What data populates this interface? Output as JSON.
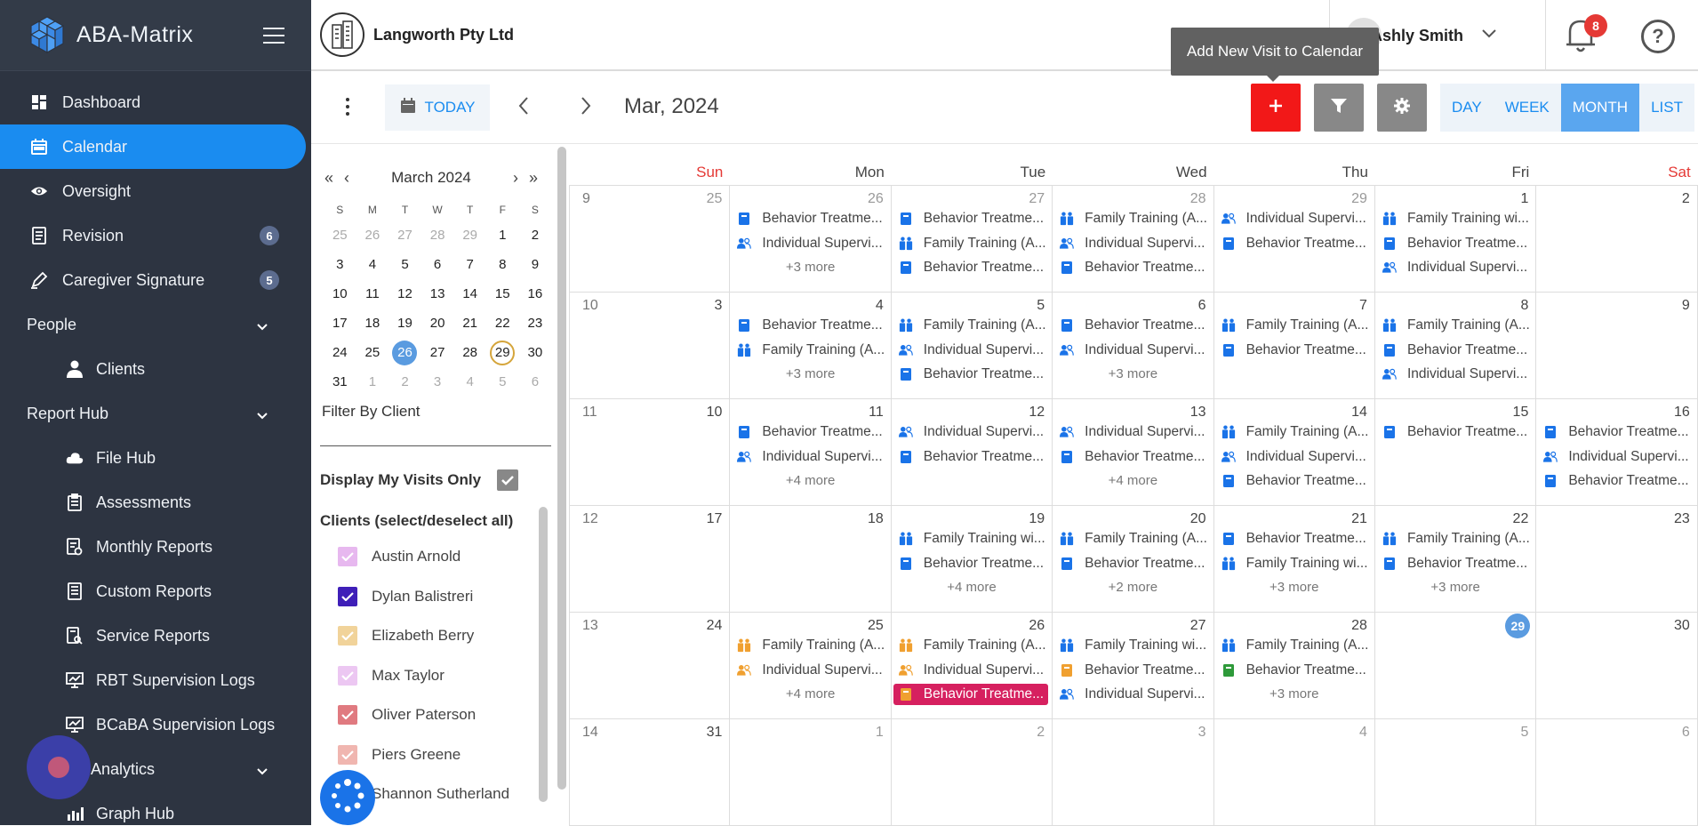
{
  "app": {
    "name": "ABA-Matrix"
  },
  "sidebar": {
    "items": [
      {
        "label": "Dashboard",
        "icon": "dashboard-icon"
      },
      {
        "label": "Calendar",
        "icon": "calendar-icon",
        "active": true
      },
      {
        "label": "Oversight",
        "icon": "eye-icon"
      },
      {
        "label": "Revision",
        "icon": "document-icon",
        "badge": "6"
      },
      {
        "label": "Caregiver Signature",
        "icon": "pen-icon",
        "badge": "5"
      }
    ],
    "people": {
      "label": "People",
      "items": [
        {
          "label": "Clients"
        }
      ]
    },
    "report_hub": {
      "label": "Report Hub",
      "items": [
        {
          "label": "File Hub"
        },
        {
          "label": "Assessments"
        },
        {
          "label": "Monthly Reports"
        },
        {
          "label": "Custom Reports"
        },
        {
          "label": "Service Reports"
        },
        {
          "label": "RBT Supervision Logs"
        },
        {
          "label": "BCaBA Supervision Logs"
        }
      ]
    },
    "analytics": {
      "label": "Analytics",
      "items": [
        {
          "label": "Graph Hub"
        }
      ]
    }
  },
  "topbar": {
    "company": "Langworth Pty Ltd",
    "user": "Ashly Smith",
    "notifications": "8",
    "tooltip": "Add New Visit to Calendar"
  },
  "toolbar": {
    "today": "TODAY",
    "month_label": "Mar, 2024",
    "views": [
      "DAY",
      "WEEK",
      "MONTH",
      "LIST"
    ],
    "active_view": "MONTH"
  },
  "mini_calendar": {
    "title": "March 2024",
    "dow": [
      "S",
      "M",
      "T",
      "W",
      "T",
      "F",
      "S"
    ],
    "weeks": [
      [
        "25",
        "26",
        "27",
        "28",
        "29",
        "1",
        "2"
      ],
      [
        "3",
        "4",
        "5",
        "6",
        "7",
        "8",
        "9"
      ],
      [
        "10",
        "11",
        "12",
        "13",
        "14",
        "15",
        "16"
      ],
      [
        "17",
        "18",
        "19",
        "20",
        "21",
        "22",
        "23"
      ],
      [
        "24",
        "25",
        "26",
        "27",
        "28",
        "29",
        "30"
      ],
      [
        "31",
        "1",
        "2",
        "3",
        "4",
        "5",
        "6"
      ]
    ],
    "selected": "26",
    "today": "29"
  },
  "filters": {
    "filter_by_client": "Filter By Client",
    "display_my_visits": "Display My Visits Only",
    "clients_header": "Clients (select/deselect all)",
    "clients": [
      {
        "name": "Austin Arnold",
        "color": "#e7b8ef"
      },
      {
        "name": "Dylan Balistreri",
        "color": "#3f1fb8"
      },
      {
        "name": "Elizabeth Berry",
        "color": "#f1d39a"
      },
      {
        "name": "Max Taylor",
        "color": "#ecc7f2"
      },
      {
        "name": "Oliver Paterson",
        "color": "#e07a80"
      },
      {
        "name": "Piers Greene",
        "color": "#f0b6b0"
      },
      {
        "name": "Shannon Sutherland",
        "color": "#5a9be0"
      }
    ]
  },
  "calendar": {
    "dow": [
      "Sun",
      "Mon",
      "Tue",
      "Wed",
      "Thu",
      "Fri",
      "Sat"
    ],
    "colors": {
      "weekend": "#e53935",
      "blue": "#1a73e8",
      "orange": "#f0a030",
      "green": "#2e9a3a",
      "highlight": "#d6205f"
    },
    "weeks": [
      {
        "wk": "9",
        "days": [
          {
            "d": "25",
            "mut": true,
            "events": []
          },
          {
            "d": "26",
            "mut": true,
            "events": [
              {
                "t": "Behavior Treatme...",
                "i": "book"
              },
              {
                "t": "Individual Supervi...",
                "i": "people"
              }
            ],
            "more": "+3 more"
          },
          {
            "d": "27",
            "mut": true,
            "events": [
              {
                "t": "Behavior Treatme...",
                "i": "book"
              },
              {
                "t": "Family Training (A...",
                "i": "family"
              },
              {
                "t": "Behavior Treatme...",
                "i": "book"
              }
            ]
          },
          {
            "d": "28",
            "mut": true,
            "events": [
              {
                "t": "Family Training (A...",
                "i": "family"
              },
              {
                "t": "Individual Supervi...",
                "i": "people"
              },
              {
                "t": "Behavior Treatme...",
                "i": "book"
              }
            ]
          },
          {
            "d": "29",
            "mut": true,
            "events": [
              {
                "t": "Individual Supervi...",
                "i": "people"
              },
              {
                "t": "Behavior Treatme...",
                "i": "book"
              }
            ]
          },
          {
            "d": "1",
            "events": [
              {
                "t": "Family Training wi...",
                "i": "family"
              },
              {
                "t": "Behavior Treatme...",
                "i": "book"
              },
              {
                "t": "Individual Supervi...",
                "i": "people"
              }
            ]
          },
          {
            "d": "2",
            "events": []
          }
        ]
      },
      {
        "wk": "10",
        "days": [
          {
            "d": "3",
            "events": []
          },
          {
            "d": "4",
            "events": [
              {
                "t": "Behavior Treatme...",
                "i": "book"
              },
              {
                "t": "Family Training (A...",
                "i": "family"
              }
            ],
            "more": "+3 more"
          },
          {
            "d": "5",
            "events": [
              {
                "t": "Family Training (A...",
                "i": "family"
              },
              {
                "t": "Individual Supervi...",
                "i": "people"
              },
              {
                "t": "Behavior Treatme...",
                "i": "book"
              }
            ]
          },
          {
            "d": "6",
            "events": [
              {
                "t": "Behavior Treatme...",
                "i": "book"
              },
              {
                "t": "Individual Supervi...",
                "i": "people"
              }
            ],
            "more": "+3 more"
          },
          {
            "d": "7",
            "events": [
              {
                "t": "Family Training (A...",
                "i": "family"
              },
              {
                "t": "Behavior Treatme...",
                "i": "book"
              }
            ]
          },
          {
            "d": "8",
            "events": [
              {
                "t": "Family Training (A...",
                "i": "family"
              },
              {
                "t": "Behavior Treatme...",
                "i": "book"
              },
              {
                "t": "Individual Supervi...",
                "i": "people"
              }
            ]
          },
          {
            "d": "9",
            "events": []
          }
        ]
      },
      {
        "wk": "11",
        "days": [
          {
            "d": "10",
            "events": []
          },
          {
            "d": "11",
            "events": [
              {
                "t": "Behavior Treatme...",
                "i": "book"
              },
              {
                "t": "Individual Supervi...",
                "i": "people"
              }
            ],
            "more": "+4 more"
          },
          {
            "d": "12",
            "events": [
              {
                "t": "Individual Supervi...",
                "i": "people"
              },
              {
                "t": "Behavior Treatme...",
                "i": "book"
              }
            ]
          },
          {
            "d": "13",
            "events": [
              {
                "t": "Individual Supervi...",
                "i": "people"
              },
              {
                "t": "Behavior Treatme...",
                "i": "book"
              }
            ],
            "more": "+4 more"
          },
          {
            "d": "14",
            "events": [
              {
                "t": "Family Training (A...",
                "i": "family"
              },
              {
                "t": "Individual Supervi...",
                "i": "people"
              },
              {
                "t": "Behavior Treatme...",
                "i": "book"
              }
            ]
          },
          {
            "d": "15",
            "events": [
              {
                "t": "Behavior Treatme...",
                "i": "book"
              }
            ]
          },
          {
            "d": "16",
            "events": [
              {
                "t": "Behavior Treatme...",
                "i": "book"
              },
              {
                "t": "Individual Supervi...",
                "i": "people"
              },
              {
                "t": "Behavior Treatme...",
                "i": "book"
              }
            ]
          }
        ]
      },
      {
        "wk": "12",
        "days": [
          {
            "d": "17",
            "events": []
          },
          {
            "d": "18",
            "events": []
          },
          {
            "d": "19",
            "events": [
              {
                "t": "Family Training wi...",
                "i": "family"
              },
              {
                "t": "Behavior Treatme...",
                "i": "book"
              }
            ],
            "more": "+4 more"
          },
          {
            "d": "20",
            "events": [
              {
                "t": "Family Training (A...",
                "i": "family"
              },
              {
                "t": "Behavior Treatme...",
                "i": "book"
              }
            ],
            "more": "+2 more"
          },
          {
            "d": "21",
            "events": [
              {
                "t": "Behavior Treatme...",
                "i": "book"
              },
              {
                "t": "Family Training wi...",
                "i": "family"
              }
            ],
            "more": "+3 more"
          },
          {
            "d": "22",
            "events": [
              {
                "t": "Family Training (A...",
                "i": "family"
              },
              {
                "t": "Behavior Treatme...",
                "i": "book"
              }
            ],
            "more": "+3 more"
          },
          {
            "d": "23",
            "events": []
          }
        ]
      },
      {
        "wk": "13",
        "days": [
          {
            "d": "24",
            "events": []
          },
          {
            "d": "25",
            "events": [
              {
                "t": "Family Training (A...",
                "i": "family",
                "c": "orange"
              },
              {
                "t": "Individual Supervi...",
                "i": "people",
                "c": "orange"
              }
            ],
            "more": "+4 more"
          },
          {
            "d": "26",
            "events": [
              {
                "t": "Family Training (A...",
                "i": "family",
                "c": "orange"
              },
              {
                "t": "Individual Supervi...",
                "i": "people",
                "c": "orange"
              },
              {
                "t": "Behavior Treatme...",
                "i": "book",
                "c": "orange",
                "hl": true
              }
            ]
          },
          {
            "d": "27",
            "events": [
              {
                "t": "Family Training wi...",
                "i": "family"
              },
              {
                "t": "Behavior Treatme...",
                "i": "book",
                "c": "orange"
              },
              {
                "t": "Individual Supervi...",
                "i": "people"
              }
            ]
          },
          {
            "d": "28",
            "events": [
              {
                "t": "Family Training (A...",
                "i": "family"
              },
              {
                "t": "Behavior Treatme...",
                "i": "book",
                "c": "green"
              }
            ],
            "more": "+3 more"
          },
          {
            "d": "29",
            "today": true,
            "events": []
          },
          {
            "d": "30",
            "events": []
          }
        ]
      },
      {
        "wk": "14",
        "days": [
          {
            "d": "31",
            "events": []
          },
          {
            "d": "1",
            "mut": true,
            "events": []
          },
          {
            "d": "2",
            "mut": true,
            "events": []
          },
          {
            "d": "3",
            "mut": true,
            "events": []
          },
          {
            "d": "4",
            "mut": true,
            "events": []
          },
          {
            "d": "5",
            "mut": true,
            "events": []
          },
          {
            "d": "6",
            "mut": true,
            "events": []
          }
        ]
      }
    ]
  }
}
